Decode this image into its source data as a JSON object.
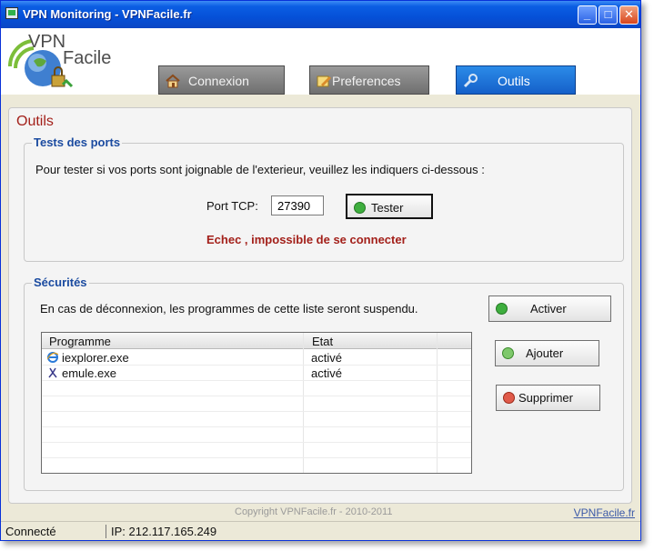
{
  "window": {
    "title": "VPN Monitoring - VPNFacile.fr"
  },
  "logo": {
    "line1": "VPN",
    "line2": "Facile"
  },
  "tabs": [
    {
      "label": "Connexion",
      "icon": "home-icon",
      "active": false
    },
    {
      "label": "Preferences",
      "icon": "notepad-icon",
      "active": false
    },
    {
      "label": "Outils",
      "icon": "wrench-icon",
      "active": true
    }
  ],
  "page": {
    "title": "Outils"
  },
  "ports": {
    "legend": "Tests des ports",
    "description": "Pour tester si vos ports sont joignable de l'exterieur, veuillez les indiquers ci-dessous :",
    "port_label": "Port TCP:",
    "port_value": "27390",
    "test_button": "Tester",
    "result": "Echec , impossible de se connecter",
    "result_color": "#a3201a"
  },
  "security": {
    "legend": "Sécurités",
    "description": "En cas de déconnexion, les programmes de cette liste seront suspendu.",
    "activate_button": "Activer",
    "add_button": "Ajouter",
    "remove_button": "Supprimer",
    "columns": [
      "Programme",
      "Etat"
    ],
    "rows": [
      {
        "program": "iexplorer.exe",
        "state": "activé",
        "icon": "internet-explorer-icon"
      },
      {
        "program": "emule.exe",
        "state": "activé",
        "icon": "emule-icon"
      }
    ]
  },
  "footer": {
    "copyright": "Copyright VPNFacile.fr - 2010-2011",
    "link": "VPNFacile.fr"
  },
  "status": {
    "connection": "Connecté",
    "ip": "IP: 212.117.165.249"
  },
  "colors": {
    "accent": "#1560c9",
    "title_red": "#a3201a",
    "legend_blue": "#1b4ba0"
  }
}
